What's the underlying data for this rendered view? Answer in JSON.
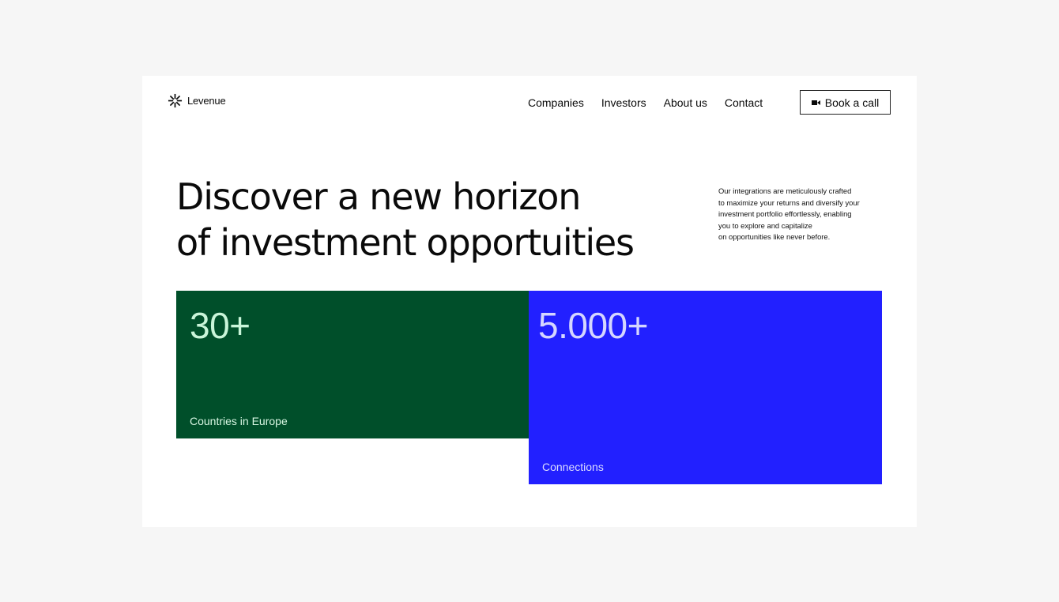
{
  "brand": {
    "name": "Levenue"
  },
  "nav": {
    "items": [
      "Companies",
      "Investors",
      "About us",
      "Contact"
    ],
    "cta_label": "Book a call",
    "cta_icon": "video-camera-icon"
  },
  "hero": {
    "headline_lines": [
      "Discover a new horizon",
      "of investment opportuities"
    ],
    "intro_lines": [
      "Our integrations are meticulously crafted",
      "to maximize your returns and diversify your",
      "investment portfolio effortlessly,  enabling",
      "you to explore and capitalize",
      "on opportunities like never before."
    ]
  },
  "stats": [
    {
      "value": "30+",
      "label": "Countries in Europe",
      "color": "#004f2a"
    },
    {
      "value": "5.000+",
      "label": "Connections",
      "color": "#2220ff"
    }
  ]
}
